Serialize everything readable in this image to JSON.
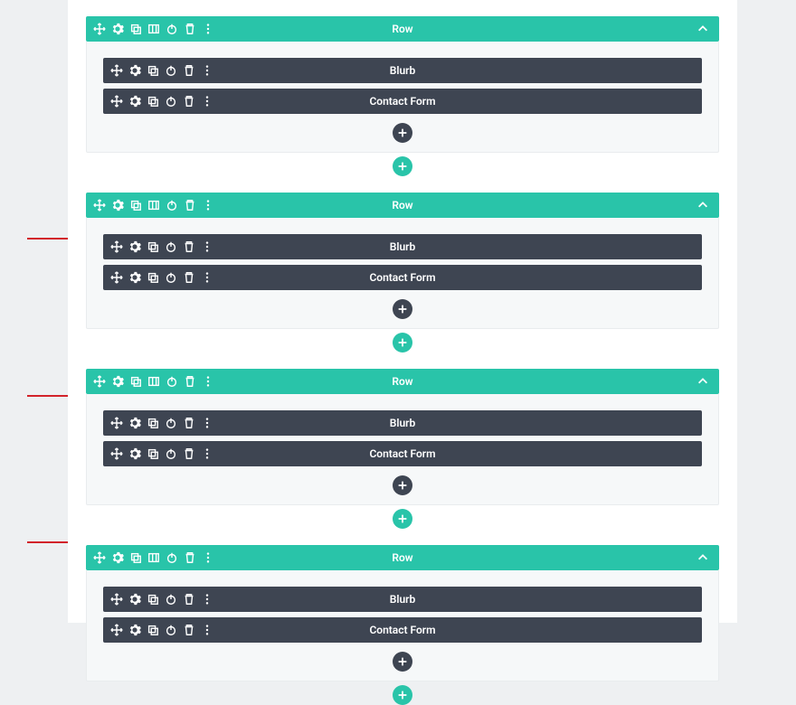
{
  "colors": {
    "row_header_bg": "#29c4a9",
    "module_bg": "#3e4552",
    "canvas_bg": "#ffffff",
    "page_bg": "#eef0f2",
    "row_body_bg": "#f6f8f9",
    "arrow_color": "#d2232a"
  },
  "icons": {
    "move": "move-icon",
    "gear": "gear-icon",
    "duplicate": "duplicate-icon",
    "columns": "columns-icon",
    "power": "power-icon",
    "trash": "trash-icon",
    "more": "more-icon",
    "chevron_up": "chevron-up-icon",
    "plus": "plus-icon"
  },
  "rows": [
    {
      "title": "Row",
      "arrow": false,
      "modules": [
        {
          "title": "Blurb"
        },
        {
          "title": "Contact Form"
        }
      ]
    },
    {
      "title": "Row",
      "arrow": true,
      "modules": [
        {
          "title": "Blurb"
        },
        {
          "title": "Contact Form"
        }
      ]
    },
    {
      "title": "Row",
      "arrow": true,
      "modules": [
        {
          "title": "Blurb"
        },
        {
          "title": "Contact Form"
        }
      ]
    },
    {
      "title": "Row",
      "arrow": true,
      "modules": [
        {
          "title": "Blurb"
        },
        {
          "title": "Contact Form"
        }
      ]
    }
  ]
}
